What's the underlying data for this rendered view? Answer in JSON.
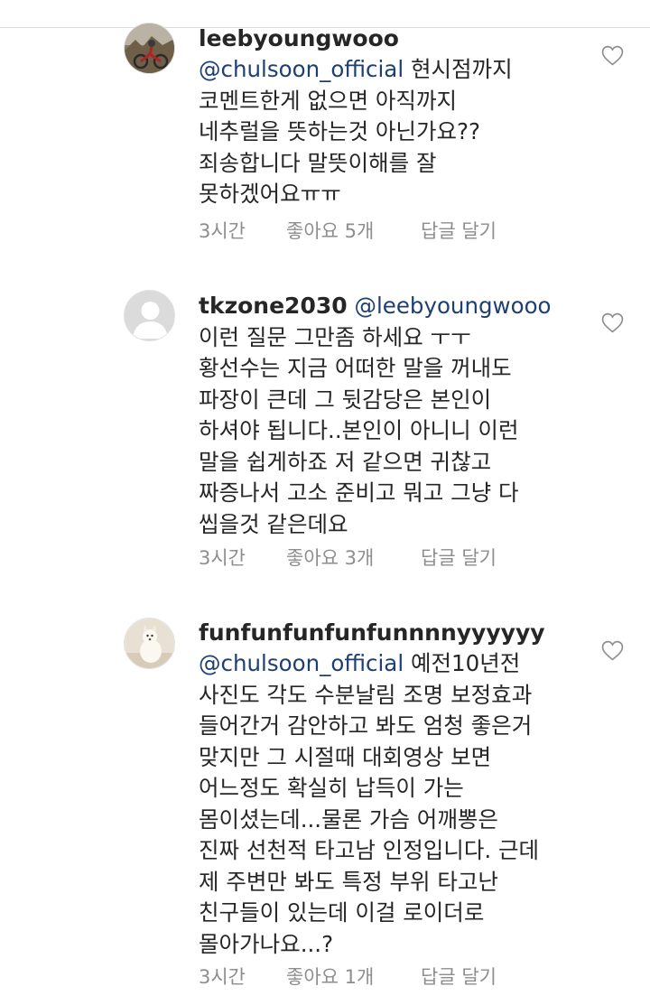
{
  "comments": [
    {
      "username": "leebyoungwooo",
      "mention": "@chulsoon_official",
      "lines": [
        "현시점까지",
        "코멘트한게 없으면 아직까지",
        "네추럴을 뜻하는것 아닌가요??",
        "죄송합니다 말뜻이해를 잘",
        "못하겠어요ㅠㅠ"
      ],
      "time": "3시간",
      "likes": "좋아요 5개",
      "reply": "답글 달기"
    },
    {
      "username": "tkzone2030",
      "mention": "@leebyoungwooo",
      "lines": [
        "이런 질문 그만좀 하세요 ㅜㅜ",
        "황선수는 지금 어떠한 말을 꺼내도",
        "파장이 큰데 그 뒷감당은 본인이",
        "하셔야 됩니다..본인이 아니니 이런",
        "말을 쉽게하죠 저 같으면 귀찮고",
        "짜증나서 고소 준비고 뭐고 그냥 다",
        "씹을것 같은데요"
      ],
      "time": "3시간",
      "likes": "좋아요 3개",
      "reply": "답글 달기"
    },
    {
      "username": "funfunfunfunfunnnnyyyyyy",
      "mention": "@chulsoon_official",
      "lines": [
        "예전10년전",
        "사진도 각도 수분날림 조명 보정효과",
        "들어간거 감안하고 봐도 엄청 좋은거",
        "맞지만 그 시절때 대회영상 보면",
        "어느정도 확실히 납득이 가는",
        "몸이셨는데...물론 가슴 어깨뽕은",
        "진짜 선천적 타고남 인정입니다. 근데",
        "제 주변만 봐도 특정 부위 타고난",
        "친구들이 있는데 이걸 로이더로",
        "몰아가나요...?"
      ],
      "time": "3시간",
      "likes": "좋아요 1개",
      "reply": "답글 달기"
    }
  ],
  "colors": {
    "mention": "#1e3f75",
    "meta": "#8e8e8e",
    "text": "#262626"
  },
  "icons": {
    "like": "heart-outline-icon"
  }
}
